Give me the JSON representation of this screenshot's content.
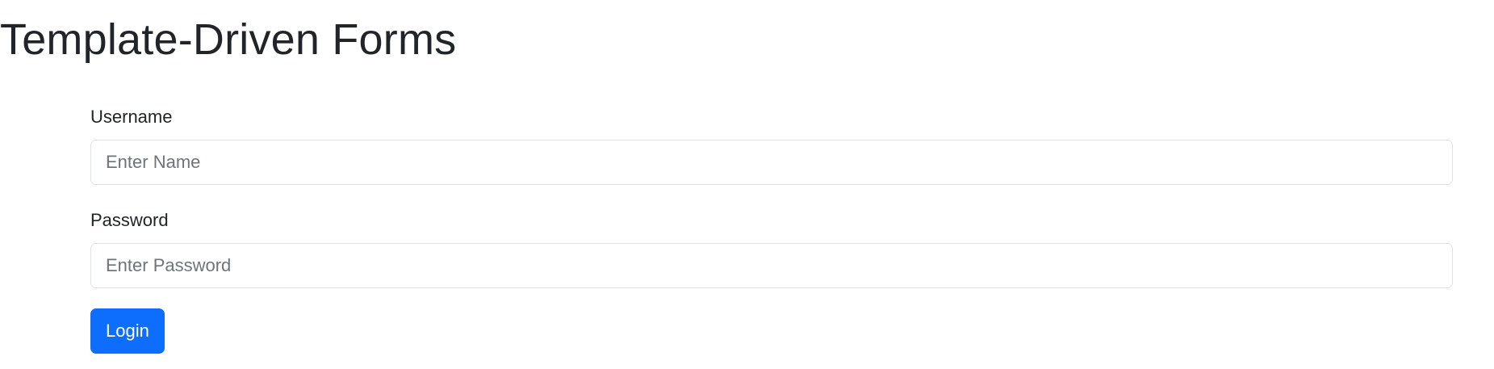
{
  "page": {
    "title": "Template-Driven Forms"
  },
  "form": {
    "username": {
      "label": "Username",
      "placeholder": "Enter Name",
      "value": ""
    },
    "password": {
      "label": "Password",
      "placeholder": "Enter Password",
      "value": ""
    },
    "submit_label": "Login"
  },
  "colors": {
    "primary_button": "#0d6efd",
    "text": "#212529",
    "input_border": "#dee2e6",
    "placeholder": "#6c757d"
  }
}
